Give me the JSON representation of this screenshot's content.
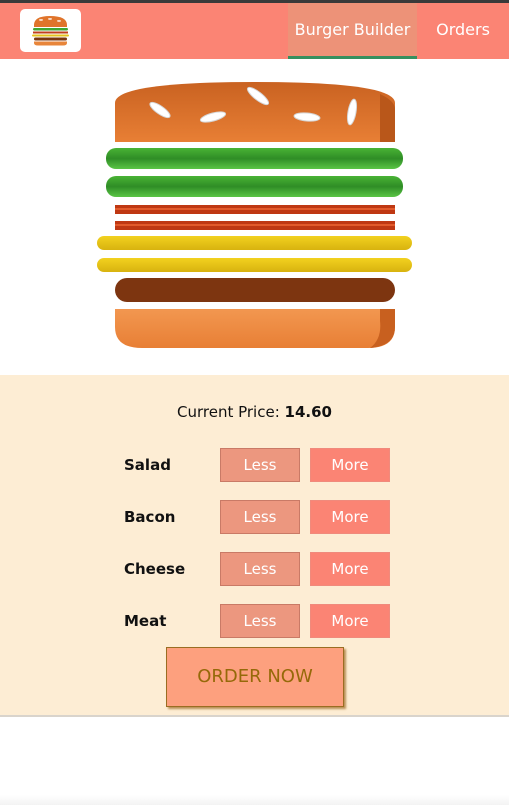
{
  "app": {
    "logo_icon": "burger-logo-icon",
    "nav": [
      {
        "label": "Burger Builder",
        "active": true
      },
      {
        "label": "Orders",
        "active": false
      }
    ],
    "colors": {
      "toolbar": "#fb8474",
      "active_tab": "#ed9278",
      "active_underline": "#35905f",
      "controls_bg": "#fdedd4",
      "less_button": "#ec977f",
      "more_button": "#fb8474",
      "order_button": "#fda07e"
    }
  },
  "burger": {
    "layers": [
      "bread-top",
      "salad",
      "salad",
      "bacon",
      "bacon",
      "cheese",
      "cheese",
      "meat",
      "bread-bottom"
    ]
  },
  "controls": {
    "price_label": "Current Price:",
    "price_value": "14.60",
    "ingredients": [
      {
        "label": "Salad",
        "less": "Less",
        "more": "More"
      },
      {
        "label": "Bacon",
        "less": "Less",
        "more": "More"
      },
      {
        "label": "Cheese",
        "less": "Less",
        "more": "More"
      },
      {
        "label": "Meat",
        "less": "Less",
        "more": "More"
      }
    ],
    "order_label": "ORDER NOW"
  }
}
